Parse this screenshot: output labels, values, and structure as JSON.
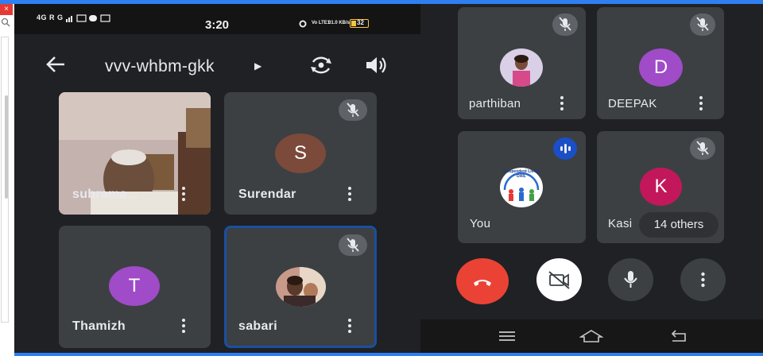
{
  "status_bar": {
    "left_indicators": "4G R G",
    "time": "3:20",
    "volte": "Vo LTE1",
    "speed": "31.0 KB/s",
    "battery": "32"
  },
  "meeting": {
    "code": "vvv-whbm-gkk"
  },
  "left_tiles": [
    {
      "name": "subrama...",
      "muted": false,
      "video": true
    },
    {
      "name": "Surendar",
      "initial": "S",
      "avatar_color": "#7b4a3a",
      "muted": true
    },
    {
      "name": "Thamizh",
      "initial": "T",
      "avatar_color": "#a04bc8",
      "muted": false
    },
    {
      "name": "sabari",
      "muted": true,
      "active_speaker": true
    }
  ],
  "right_tiles": [
    {
      "name": "parthiban",
      "muted": true
    },
    {
      "name": "DEEPAK",
      "initial": "D",
      "avatar_color": "#a04bc8",
      "muted": true
    },
    {
      "name": "You",
      "muted": false,
      "speaking": true
    },
    {
      "name": "Kasi",
      "initial": "K",
      "avatar_color": "#c2185b",
      "muted": true
    }
  ],
  "you_logo_text": "Independent Living DAIL",
  "others_label": "14 others",
  "controls": {
    "end_call_color": "#ea4335",
    "camera_bg": "#ffffff",
    "mic_bg": "#3c4043",
    "more_bg": "#3c4043"
  },
  "icons": {
    "back": "arrow-left-icon",
    "flip": "flip-camera-icon",
    "speaker": "speaker-icon",
    "mic_off": "mic-off-icon",
    "speaking": "audio-level-icon",
    "end_call": "phone-hangup-icon",
    "camera_off": "videocam-off-icon",
    "mic": "mic-icon",
    "more": "more-vert-icon",
    "nav_menu": "menu-icon",
    "nav_home": "home-icon",
    "nav_back": "back-nav-icon"
  },
  "colors": {
    "accent_blue": "#2f7ff0",
    "active_border": "#1a4fa0",
    "tile_bg": "#3c4043",
    "app_bg": "#202124"
  },
  "window_strip": {
    "close_glyph": "×",
    "search_glyph": "🔍"
  }
}
